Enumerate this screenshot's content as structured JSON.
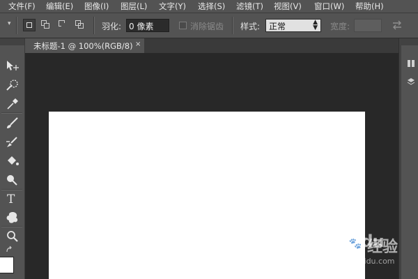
{
  "menubar": {
    "items": [
      "文件(F)",
      "编辑(E)",
      "图像(I)",
      "图层(L)",
      "文字(Y)",
      "选择(S)",
      "滤镜(T)",
      "视图(V)",
      "窗口(W)",
      "帮助(H)"
    ]
  },
  "options": {
    "feather_label": "羽化:",
    "feather_value": "0 像素",
    "antialias_label": "消除锯齿",
    "style_label": "样式:",
    "style_value": "正常",
    "width_label": "宽度:"
  },
  "document": {
    "tab_title": "未标题-1 @ 100%(RGB/8)",
    "close_glyph": "×"
  },
  "toolbar": {
    "type_tool_glyph": "T",
    "tools": [
      "move-icon",
      "quick-selection-icon",
      "eyedropper-icon",
      "brush-icon",
      "clone-stamp-icon",
      "paint-bucket-icon",
      "dodge-icon",
      "type-icon",
      "custom-shape-icon",
      "zoom-icon",
      "swap-colors-icon"
    ]
  },
  "colors": {
    "chrome": "#535353",
    "workspace": "#282828",
    "canvas": "#ffffff"
  },
  "watermark": {
    "brand": "Bai",
    "paw": "du",
    "product": "经验",
    "url": "jingyan.baidu.com"
  }
}
